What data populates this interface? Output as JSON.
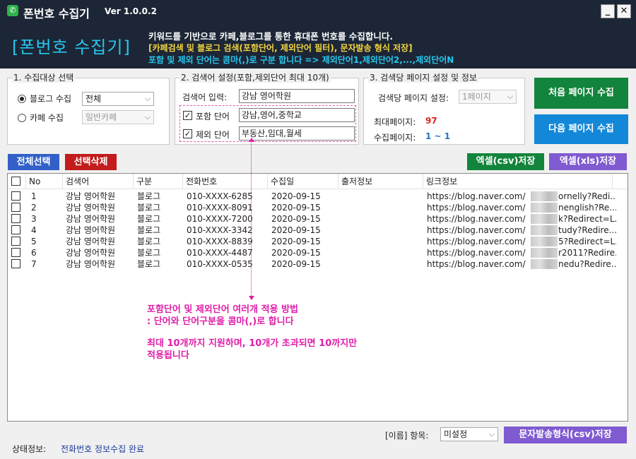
{
  "window": {
    "title": "폰번호 수집기",
    "version": "Ver 1.0.0.2",
    "minimize": "_",
    "close": "✕"
  },
  "header": {
    "brand": "[폰번호 수집기]",
    "line1": "키워드를 기반으로 카페,블로그를 통한 휴대폰 번호를 수집합니다.",
    "line2": "[카페검색 및 블로그 검색(포함단어, 제외단어 필터), 문자발송 형식 저장]",
    "line3": "포함 및 제외 단어는 콤마(,)로 구분 합니다 => 제외단어1,제외단어2,...,제외단어N"
  },
  "target": {
    "title": "1. 수집대상 선택",
    "blog_label": "블로그 수집",
    "blog_value": "전체",
    "cafe_label": "카페 수집",
    "cafe_value": "일반카페",
    "selected": "blog"
  },
  "search": {
    "title": "2. 검색어 설정(포함,제외단어 최대 10개)",
    "keyword_label": "검색어 입력:",
    "keyword_value": "강남 영어학원",
    "include_label": "포함 단어",
    "include_value": "강남,영어,중학교",
    "include_checked": true,
    "exclude_label": "제외 단어",
    "exclude_value": "부동산,임대,월세",
    "exclude_checked": true
  },
  "pages": {
    "title": "3. 검색당 페이지 설정 및 정보",
    "per_search_label": "검색당 페이지 설정:",
    "per_search_value": "1페이지",
    "max_label": "최대페이지:",
    "max_value": "97",
    "collected_label": "수집페이지:",
    "collected_value": "1 ~ 1"
  },
  "buttons": {
    "first_page": "처음 페이지 수집",
    "next_page": "다음 페이지 수집",
    "select_all": "전체선택",
    "delete_selected": "선택삭제",
    "excel_csv": "엑셀(csv)저장",
    "excel_xls": "엑셀(xls)저장",
    "sms_csv": "문자발송형식(csv)저장"
  },
  "table": {
    "columns": [
      "No",
      "검색어",
      "구분",
      "전화번호",
      "수집일",
      "출저정보",
      "링크정보"
    ],
    "rows": [
      {
        "no": "1",
        "keyword": "강남 영어학원",
        "type": "블로그",
        "phone": "010-XXXX-6285",
        "date": "2020-09-15",
        "source": "",
        "link_prefix": "https://blog.naver.com/",
        "link_suffix": "ornelly?Redi..."
      },
      {
        "no": "2",
        "keyword": "강남 영어학원",
        "type": "블로그",
        "phone": "010-XXXX-8091",
        "date": "2020-09-15",
        "source": "",
        "link_prefix": "https://blog.naver.com/",
        "link_suffix": "nenglish?Re..."
      },
      {
        "no": "3",
        "keyword": "강남 영어학원",
        "type": "블로그",
        "phone": "010-XXXX-7200",
        "date": "2020-09-15",
        "source": "",
        "link_prefix": "https://blog.naver.com/",
        "link_suffix": "k?Redirect=L..."
      },
      {
        "no": "4",
        "keyword": "강남 영어학원",
        "type": "블로그",
        "phone": "010-XXXX-3342",
        "date": "2020-09-15",
        "source": "",
        "link_prefix": "https://blog.naver.com/",
        "link_suffix": "tudy?Redire..."
      },
      {
        "no": "5",
        "keyword": "강남 영어학원",
        "type": "블로그",
        "phone": "010-XXXX-8839",
        "date": "2020-09-15",
        "source": "",
        "link_prefix": "https://blog.naver.com/",
        "link_suffix": "5?Redirect=L..."
      },
      {
        "no": "6",
        "keyword": "강남 영어학원",
        "type": "블로그",
        "phone": "010-XXXX-4487",
        "date": "2020-09-15",
        "source": "",
        "link_prefix": "https://blog.naver.com/",
        "link_suffix": "r2011?Redire..."
      },
      {
        "no": "7",
        "keyword": "강남 영어학원",
        "type": "블로그",
        "phone": "010-XXXX-0535",
        "date": "2020-09-15",
        "source": "",
        "link_prefix": "https://blog.naver.com/",
        "link_suffix": "nedu?Redire..."
      }
    ]
  },
  "annotation": {
    "line1": "포함단어 및 제외단어 여러개 적용 방법",
    "line2": ": 단어와 단어구분을 콤마(,)로 합니다",
    "line3": "최대 10개까지 지원하며, 10개가 초과되면 10까지만",
    "line4": "적용됩니다"
  },
  "footer": {
    "name_field_label": "[이름] 항목:",
    "name_field_value": "미설정",
    "status_label": "상태정보:",
    "status_value": "전화번호 정보수집 완료"
  },
  "colors": {
    "header_bg": "#1c2636",
    "brand": "#27c7ee",
    "highlight_yellow": "#f4d53c",
    "annotation_pink": "#e01ea8",
    "green_button": "#13843b",
    "blue_button": "#1488d8",
    "purple_button": "#7f5ad0",
    "red_button": "#c21c1c",
    "status_text": "#1a3c9c"
  }
}
